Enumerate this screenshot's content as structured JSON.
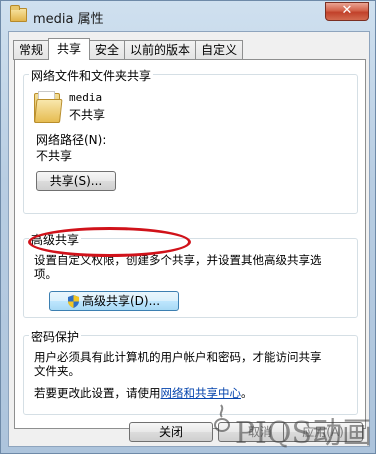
{
  "window": {
    "title": "media 属性",
    "close_glyph": "✕"
  },
  "tabs": [
    {
      "label": "常规"
    },
    {
      "label": "共享",
      "active": true
    },
    {
      "label": "安全"
    },
    {
      "label": "以前的版本"
    },
    {
      "label": "自定义"
    }
  ],
  "network_sharing": {
    "title": "网络文件和文件夹共享",
    "folder_name": "media",
    "folder_status": "不共享",
    "path_label": "网络路径(N):",
    "path_value": "不共享",
    "share_button": "共享(S)..."
  },
  "advanced_sharing": {
    "title": "高级共享",
    "description_line1": "设置自定义权限，创建多个共享，并设置其他高级共享选",
    "description_line2": "项。",
    "button": "高级共享(D)..."
  },
  "password_protection": {
    "title": "密码保护",
    "line1": "用户必须具有此计算机的用户帐户和密码，才能访问共享",
    "line2": "文件夹。",
    "line3_prefix": "若要更改此设置，请使用",
    "link": "网络和共享中心",
    "line3_suffix": "。"
  },
  "footer": {
    "close": "关闭",
    "cancel": "取消",
    "apply": "应用(A)"
  },
  "watermark": {
    "text": "PIQS动画"
  },
  "colors": {
    "highlight_ring": "#d0121a",
    "link": "#0645ad",
    "close_button": "#c1412a"
  }
}
